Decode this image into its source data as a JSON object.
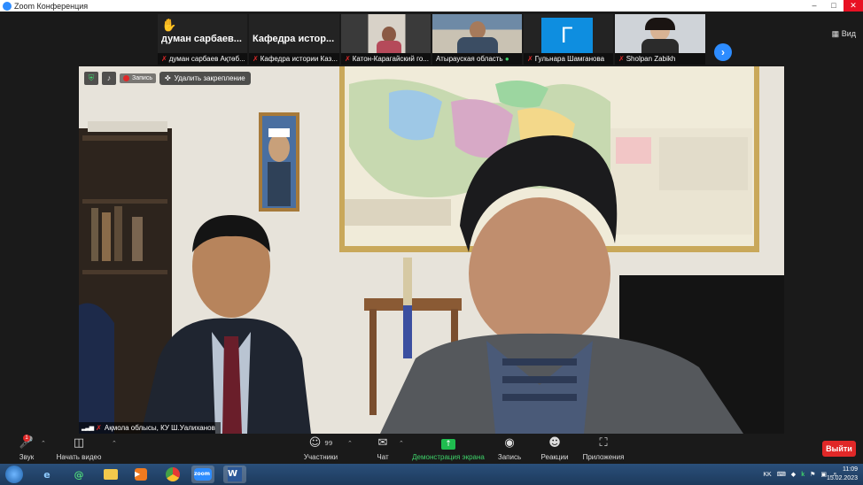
{
  "window": {
    "title": "Zoom Конференция"
  },
  "strip": {
    "view_label": "Вид",
    "tiles": [
      {
        "big_name": "думан сарбаев...",
        "caption": "думан сарбаев Ақтөб...",
        "hand": true
      },
      {
        "big_name": "Кафедра истор...",
        "caption": "Кафедра истории Каз..."
      },
      {
        "caption": "Катон-Карагайский го..."
      },
      {
        "caption": "Атырауская область"
      },
      {
        "caption": "Гульнара Шамганова",
        "letter": "Г"
      },
      {
        "caption": "Sholpan Zabikh"
      }
    ]
  },
  "main": {
    "record_label": "Запись",
    "unpin_label": "Удалить закрепление",
    "speaker_name": "Ақмола облысы, КУ Ш.Уалиханов"
  },
  "toolbar": {
    "audio_label": "Звук",
    "audio_badge": "1",
    "video_label": "Начать видео",
    "participants_label": "Участники",
    "participants_count": "99",
    "chat_label": "Чат",
    "share_label": "Демонстрация экрана",
    "record_label": "Запись",
    "reactions_label": "Реакции",
    "apps_label": "Приложения",
    "leave_label": "Выйти"
  },
  "taskbar": {
    "zoom_label": "zoom",
    "word_label": "W",
    "lang": "KK",
    "time": "11:09",
    "date": "15.02.2023"
  },
  "colors": {
    "accent": "#2d8cff",
    "leave": "#e02828",
    "share": "#1fbd4f"
  }
}
